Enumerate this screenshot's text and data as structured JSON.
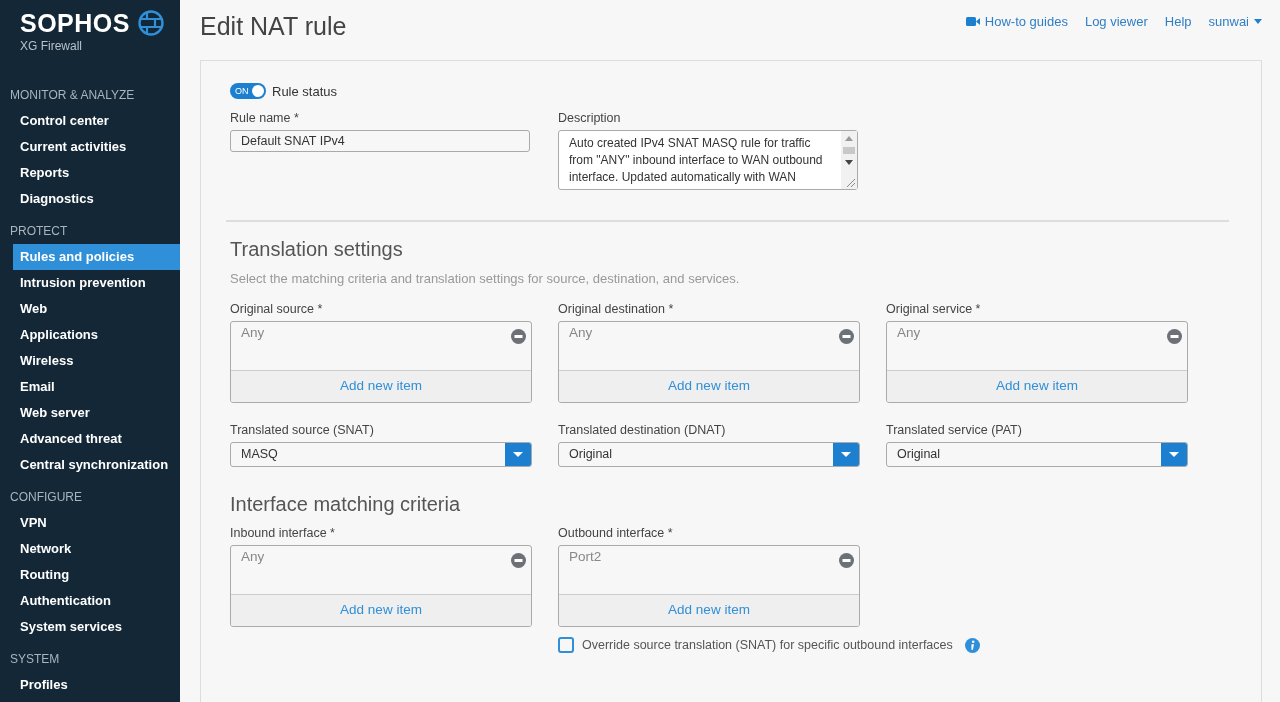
{
  "brand": {
    "name": "SOPHOS",
    "product": "XG Firewall"
  },
  "nav": [
    {
      "title": "MONITOR & ANALYZE",
      "items": [
        {
          "label": "Control center",
          "selected": false
        },
        {
          "label": "Current activities",
          "selected": false
        },
        {
          "label": "Reports",
          "selected": false
        },
        {
          "label": "Diagnostics",
          "selected": false
        }
      ]
    },
    {
      "title": "PROTECT",
      "items": [
        {
          "label": "Rules and policies",
          "selected": true
        },
        {
          "label": "Intrusion prevention",
          "selected": false
        },
        {
          "label": "Web",
          "selected": false
        },
        {
          "label": "Applications",
          "selected": false
        },
        {
          "label": "Wireless",
          "selected": false
        },
        {
          "label": "Email",
          "selected": false
        },
        {
          "label": "Web server",
          "selected": false
        },
        {
          "label": "Advanced threat",
          "selected": false
        },
        {
          "label": "Central synchronization",
          "selected": false
        }
      ]
    },
    {
      "title": "CONFIGURE",
      "items": [
        {
          "label": "VPN",
          "selected": false
        },
        {
          "label": "Network",
          "selected": false
        },
        {
          "label": "Routing",
          "selected": false
        },
        {
          "label": "Authentication",
          "selected": false
        },
        {
          "label": "System services",
          "selected": false
        }
      ]
    },
    {
      "title": "SYSTEM",
      "items": [
        {
          "label": "Profiles",
          "selected": false
        }
      ]
    }
  ],
  "header": {
    "title": "Edit NAT rule",
    "links": [
      {
        "label": "How-to guides",
        "kind": "video"
      },
      {
        "label": "Log viewer",
        "kind": "plain"
      },
      {
        "label": "Help",
        "kind": "plain"
      },
      {
        "label": "sunwai",
        "kind": "menu"
      }
    ]
  },
  "rule_status": {
    "label": "Rule status",
    "toggle_text": "ON",
    "on": true
  },
  "rule_name": {
    "label": "Rule name *",
    "value": "Default SNAT IPv4"
  },
  "description": {
    "label": "Description",
    "value": "Auto created IPv4 SNAT MASQ rule for traffic from \"ANY\" inbound interface to WAN outbound interface. Updated automatically with WAN"
  },
  "translation": {
    "heading": "Translation settings",
    "hint": "Select the matching criteria and translation settings for source, destination, and services.",
    "lists": [
      {
        "label": "Original source *",
        "items": [
          "Any"
        ],
        "add_label": "Add new item"
      },
      {
        "label": "Original destination *",
        "items": [
          "Any"
        ],
        "add_label": "Add new item"
      },
      {
        "label": "Original service *",
        "items": [
          "Any"
        ],
        "add_label": "Add new item"
      }
    ],
    "selects": [
      {
        "label": "Translated source (SNAT)",
        "value": "MASQ"
      },
      {
        "label": "Translated destination (DNAT)",
        "value": "Original"
      },
      {
        "label": "Translated service (PAT)",
        "value": "Original"
      }
    ]
  },
  "interfaces": {
    "heading": "Interface matching criteria",
    "lists": [
      {
        "label": "Inbound interface *",
        "items": [
          "Any"
        ],
        "add_label": "Add new item"
      },
      {
        "label": "Outbound interface *",
        "items": [
          "Port2"
        ],
        "add_label": "Add new item"
      }
    ],
    "override": {
      "label": "Override source translation (SNAT) for specific outbound interfaces",
      "checked": false
    }
  }
}
